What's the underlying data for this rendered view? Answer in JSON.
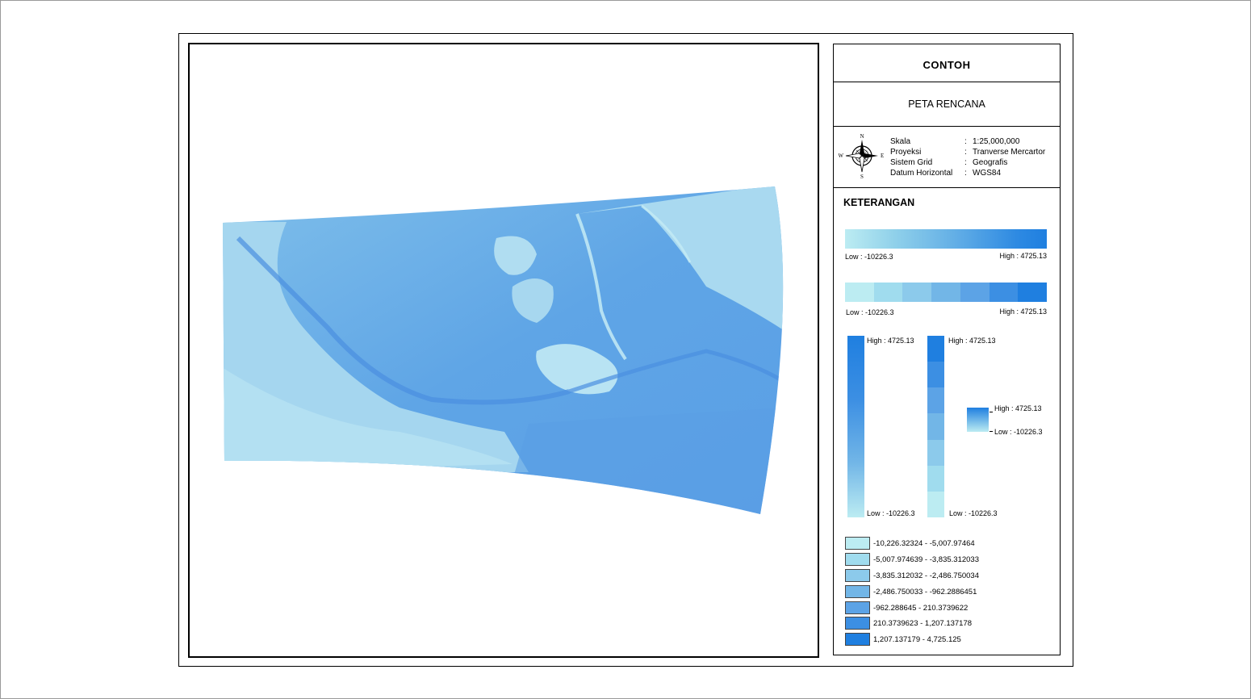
{
  "title": "CONTOH",
  "subtitle": "PETA RENCANA",
  "compass": {
    "n": "N",
    "s": "S",
    "e": "E",
    "w": "W"
  },
  "info": [
    {
      "key": "Skala",
      "value": "1:25,000,000"
    },
    {
      "key": "Proyeksi",
      "value": "Tranverse Mercartor"
    },
    {
      "key": "Sistem Grid",
      "value": "Geografis"
    },
    {
      "key": "Datum Horizontal",
      "value": "WGS84"
    }
  ],
  "legend": {
    "heading": "KETERANGAN",
    "low_label": "Low : -10226.3",
    "high_label": "High : 4725.13",
    "classes": [
      {
        "label": "-10,226.32324 - -5,007.97464",
        "color": "#bcecf2"
      },
      {
        "label": "-5,007.974639 - -3,835.312033",
        "color": "#a0dcee"
      },
      {
        "label": "-3,835.312032 - -2,486.750034",
        "color": "#8ccaeb"
      },
      {
        "label": "-2,486.750033 - -962.2886451",
        "color": "#72b6e7"
      },
      {
        "label": "-962.288645 - 210.3739622",
        "color": "#5ca3e6"
      },
      {
        "label": "210.3739623 - 1,207.137178",
        "color": "#3c8fe3"
      },
      {
        "label": "1,207.137179 - 4,725.125",
        "color": "#1f7fe0"
      }
    ]
  },
  "colors": {
    "deep": "#5a9fe5",
    "shallow": "#a8d8f0",
    "ridge": "#4a8fe0"
  }
}
